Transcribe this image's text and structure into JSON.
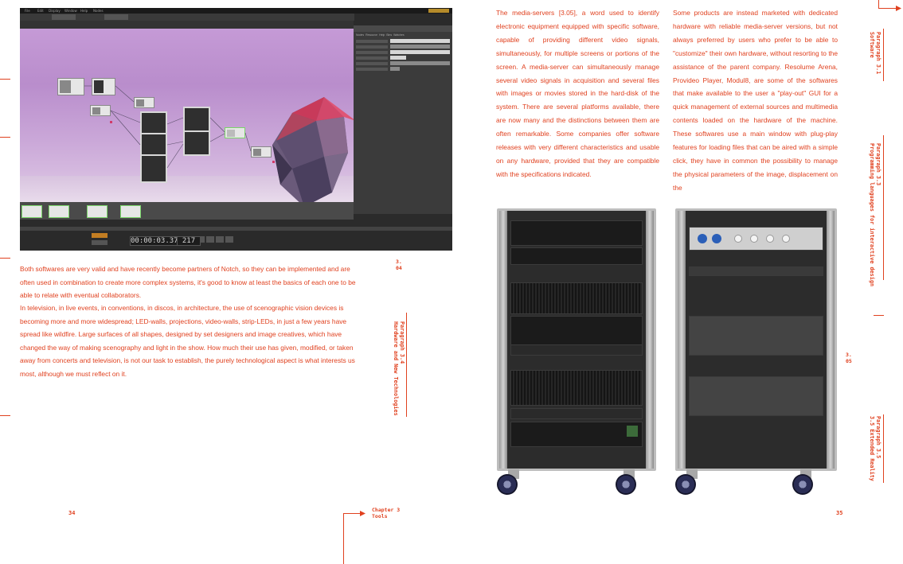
{
  "left_page": {
    "screenshot": {
      "menu_items": [
        "File",
        "Edit",
        "Display",
        "Window",
        "Help",
        "Nodes"
      ],
      "panel_tabs": [
        "Nodes",
        "Resource",
        "Help",
        "Bins",
        "Watches"
      ],
      "timecode": "00:00:03.37",
      "frame": "217"
    },
    "paragraph_1": "Both softwares are very valid and have recently become partners of Notch, so they can be implemented and are often used in combination to create more complex systems, it's good to know at least the basics of each one to be able to relate with eventual collaborators.",
    "paragraph_2": "In television, in live events, in conventions, in discos, in architecture, the use of scenographic vision devices is becoming more and more widespread; LED-walls, projections, video-walls, strip-LEDs, in just a few years have spread like wildfire. Large surfaces of all shapes, designed by set designers and image creatives, which have changed the way of making scenography and light in the show. How much their use has given, modified, or taken away from concerts and television, is not our task to establish, the purely technological aspect is what interests us most, although we must reflect on it.",
    "figure_ref": "3.\n04",
    "side_label": "Paragraph 3.4\nHardware and New Technologies",
    "page_number": "34",
    "chapter": "Chapter 3\nTools"
  },
  "right_page": {
    "col_1": "The media-servers [3.05], a word used to identify electronic equipment equipped with specific software, capable of providing different video signals, simultaneously, for multiple screens or portions of the screen. A media-server can simultaneously manage several video signals in acquisition and several files with images or movies stored in the hard-disk of the system. There are several platforms available, there are now many and the distinctions between them are often remarkable. Some companies offer software releases with very different characteristics and usable on any hardware, provided that they are compatible with the specifications indicated.",
    "col_2": "Some products are instead marketed with dedicated hardware with reliable media-server versions, but not always preferred by users who prefer to be able to \"customize\" their own hardware, without resorting to the assistance of the parent company. Resolume Arena, Provideo Player, Modul8, are some of the softwares that make available to the user a \"play-out\" GUI for a quick management of external sources and multimedia contents loaded on the hardware of the machine. These softwares use a main window with plug-play features for loading files that can be aired with a simple click, they have in common the possibility to manage the physical parameters of the image, displacement on the",
    "figure_ref": "3.\n05",
    "side_label_1": "Paragraph 3.1\nSoftware",
    "side_label_2": "Paragraph 3.3\nProgramming languages for interactive design",
    "side_label_3": "Paragraph 3.5\n3.5 Extended Reality",
    "page_number": "35"
  },
  "colors": {
    "accent": "#e0411f"
  }
}
